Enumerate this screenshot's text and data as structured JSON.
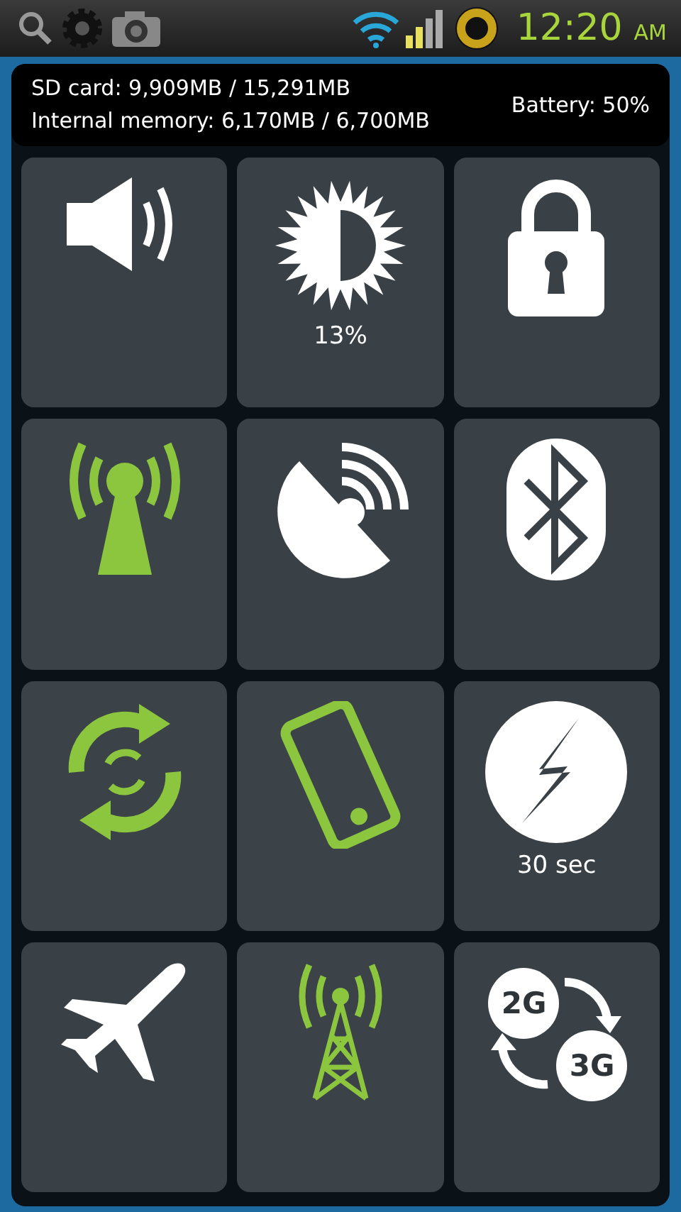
{
  "status_bar": {
    "time": "12:20",
    "meridiem": "AM"
  },
  "storage_info": {
    "sd_card": "SD card: 9,909MB / 15,291MB",
    "internal_memory": "Internal memory: 6,170MB / 6,700MB",
    "battery": "Battery: 50%"
  },
  "tiles": [
    {
      "kind": "volume",
      "on": false
    },
    {
      "kind": "brightness",
      "on": false,
      "value": "13%"
    },
    {
      "kind": "lock",
      "on": false
    },
    {
      "kind": "hotspot",
      "on": true
    },
    {
      "kind": "gps",
      "on": false
    },
    {
      "kind": "bluetooth",
      "on": false
    },
    {
      "kind": "sync",
      "on": true
    },
    {
      "kind": "rotation",
      "on": true
    },
    {
      "kind": "timeout",
      "on": false,
      "value": "30 sec"
    },
    {
      "kind": "airplane",
      "on": false
    },
    {
      "kind": "data",
      "on": true
    },
    {
      "kind": "network_mode",
      "on": false,
      "labels": [
        "2G",
        "3G"
      ]
    }
  ]
}
